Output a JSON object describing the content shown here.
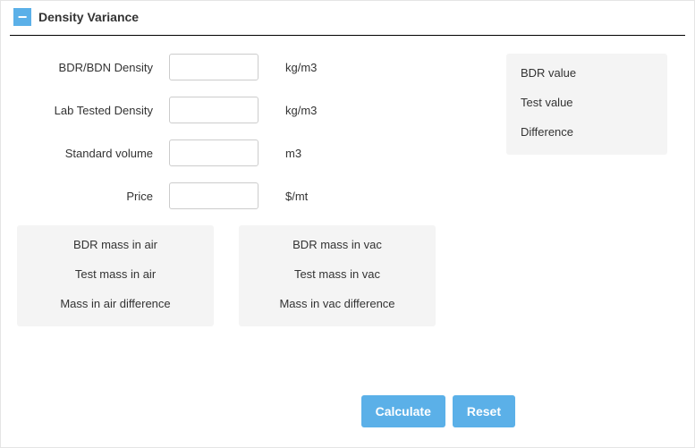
{
  "header": {
    "title": "Density Variance",
    "collapse_glyph": "−"
  },
  "form": {
    "rows": [
      {
        "label": "BDR/BDN Density",
        "value": "",
        "unit": "kg/m3"
      },
      {
        "label": "Lab Tested Density",
        "value": "",
        "unit": "kg/m3"
      },
      {
        "label": "Standard volume",
        "value": "",
        "unit": "m3"
      },
      {
        "label": "Price",
        "value": "",
        "unit": "$/mt"
      }
    ]
  },
  "side_panel": {
    "rows": [
      "BDR value",
      "Test value",
      "Difference"
    ]
  },
  "result_cols": {
    "left": [
      "BDR mass in air",
      "Test mass in air",
      "Mass in air difference"
    ],
    "right": [
      "BDR mass in vac",
      "Test mass in vac",
      "Mass in vac difference"
    ]
  },
  "buttons": {
    "calculate": "Calculate",
    "reset": "Reset"
  }
}
